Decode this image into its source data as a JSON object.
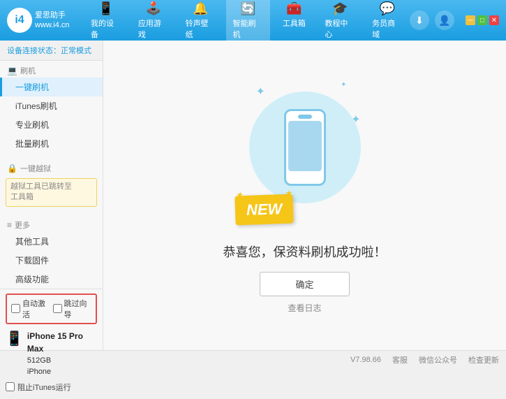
{
  "app": {
    "logo_text_line1": "爱思助手",
    "logo_text_line2": "www.i4.cn",
    "logo_letter": "i4"
  },
  "nav": {
    "items": [
      {
        "id": "my-device",
        "icon": "📱",
        "label": "我的设备"
      },
      {
        "id": "app-games",
        "icon": "👤",
        "label": "应用游戏"
      },
      {
        "id": "ringtones",
        "icon": "🔔",
        "label": "铃声壁纸"
      },
      {
        "id": "smart-flash",
        "icon": "🔄",
        "label": "智能刷机",
        "active": true
      },
      {
        "id": "toolbox",
        "icon": "🧰",
        "label": "工具箱"
      },
      {
        "id": "tutorial",
        "icon": "🎓",
        "label": "教程中心"
      },
      {
        "id": "service",
        "icon": "💬",
        "label": "务员商域"
      }
    ]
  },
  "sidebar": {
    "status_label": "设备连接状态：",
    "status_value": "正常模式",
    "sections": [
      {
        "title": "刷机",
        "icon": "💻",
        "items": [
          {
            "id": "one-click-flash",
            "label": "一键刷机",
            "active": true
          },
          {
            "id": "itunes-flash",
            "label": "iTunes刷机"
          },
          {
            "id": "pro-flash",
            "label": "专业刷机"
          },
          {
            "id": "batch-flash",
            "label": "批量刷机"
          }
        ]
      },
      {
        "title": "一键越狱",
        "icon": "🔒",
        "disabled": true,
        "warning": "越狱工具已跳转至\n工具箱"
      }
    ],
    "more_section": {
      "title": "更多",
      "items": [
        {
          "id": "other-tools",
          "label": "其他工具"
        },
        {
          "id": "download-firmware",
          "label": "下载固件"
        },
        {
          "id": "advanced",
          "label": "高级功能"
        }
      ]
    },
    "auto_activate": "自动激活",
    "guided_activate": "跳过向导",
    "device": {
      "name": "iPhone 15 Pro Max",
      "storage": "512GB",
      "type": "iPhone"
    },
    "itunes_label": "阻止iTunes运行"
  },
  "content": {
    "success_title": "恭喜您，保资料刷机成功啦！",
    "confirm_button": "确定",
    "log_link": "查看日志"
  },
  "footer": {
    "version": "V7.98.66",
    "links": [
      "客服",
      "微信公众号",
      "检查更新"
    ]
  }
}
